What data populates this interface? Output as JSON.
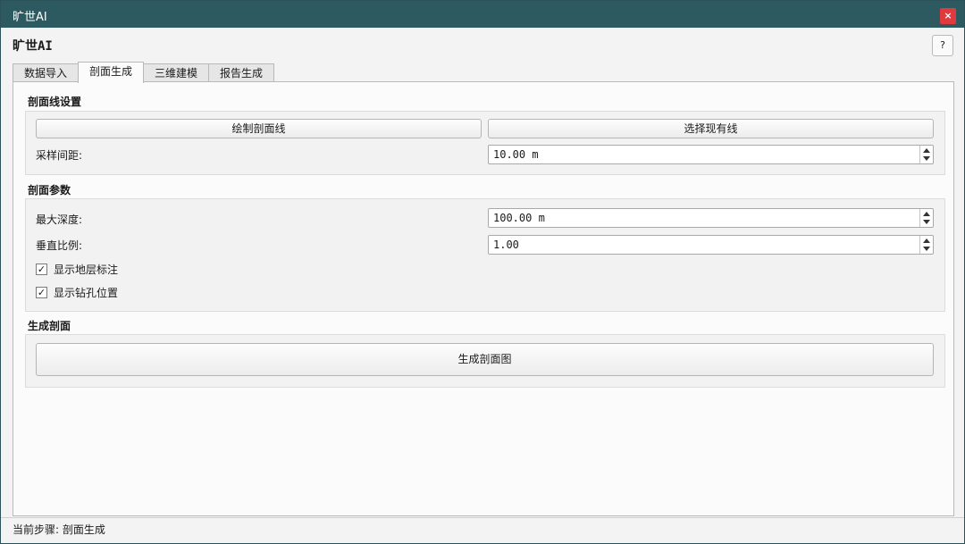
{
  "window": {
    "title": "旷世AI",
    "close_label": "×"
  },
  "app": {
    "title": "旷世AI",
    "help_label": "?"
  },
  "tabs": [
    {
      "label": "数据导入",
      "active": false
    },
    {
      "label": "剖面生成",
      "active": true
    },
    {
      "label": "三维建模",
      "active": false
    },
    {
      "label": "报告生成",
      "active": false
    }
  ],
  "section1": {
    "title": "剖面线设置",
    "draw_button": "绘制剖面线",
    "select_button": "选择现有线",
    "sampling_label": "采样间距:",
    "sampling_value": "10.00 m"
  },
  "section2": {
    "title": "剖面参数",
    "max_depth_label": "最大深度:",
    "max_depth_value": "100.00 m",
    "vertical_scale_label": "垂直比例:",
    "vertical_scale_value": "1.00",
    "show_layer_label": "显示地层标注",
    "show_layer_checked": true,
    "show_borehole_label": "显示钻孔位置",
    "show_borehole_checked": true
  },
  "section3": {
    "title": "生成剖面",
    "generate_button": "生成剖面图"
  },
  "status": {
    "text": "当前步骤: 剖面生成"
  }
}
